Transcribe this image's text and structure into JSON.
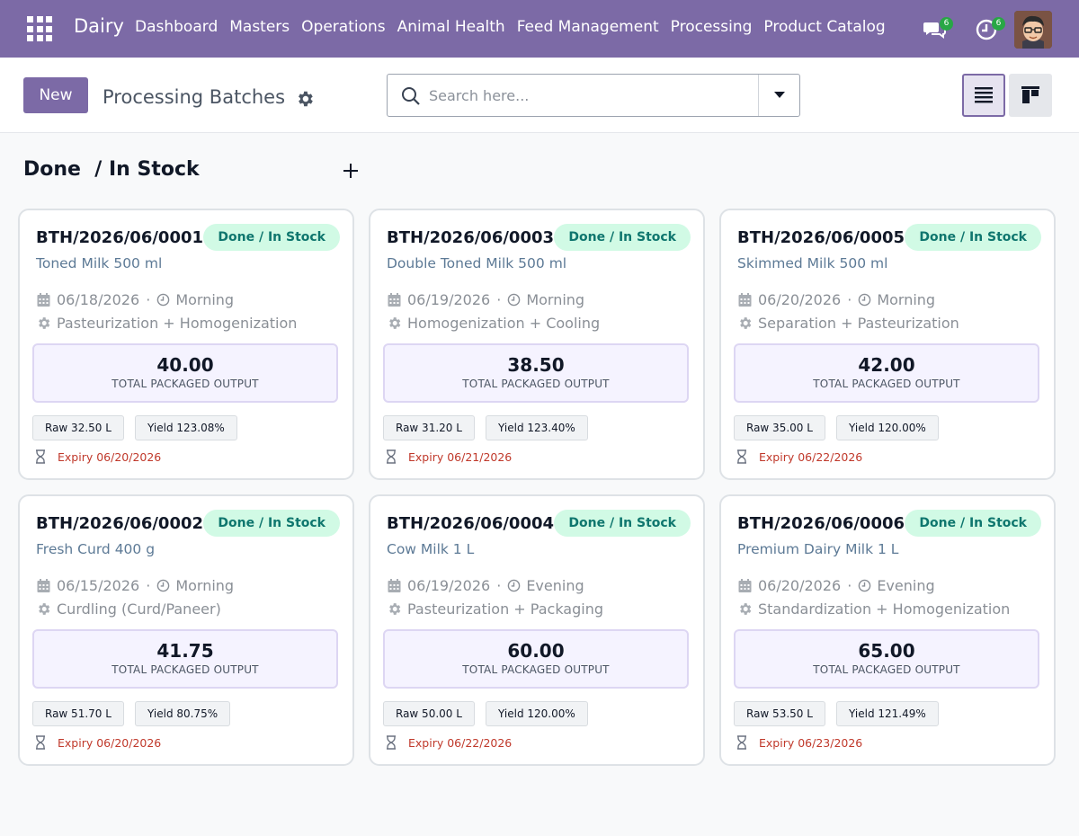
{
  "app": {
    "brand": "Dairy"
  },
  "nav": {
    "menu": [
      "Dashboard",
      "Masters",
      "Operations",
      "Animal Health",
      "Feed Management",
      "Processing",
      "Product Catalog"
    ],
    "messages_count": "6",
    "activities_count": "6"
  },
  "control": {
    "new_label": "New",
    "title": "Processing Batches",
    "search_placeholder": "Search here..."
  },
  "column": {
    "title": "Done  / In Stock"
  },
  "card_labels": {
    "output_label": "TOTAL PACKAGED OUTPUT",
    "date_sep": "·"
  },
  "cards": [
    {
      "ref": "BTH/2026/06/0001",
      "status": "Done / In Stock",
      "product": "Toned Milk 500 ml",
      "date": "06/18/2026",
      "shift": "Morning",
      "process": "Pasteurization + Homogenization",
      "output": "40.00",
      "raw": "Raw 32.50 L",
      "yield": "Yield 123.08%",
      "expiry": "Expiry 06/20/2026"
    },
    {
      "ref": "BTH/2026/06/0003",
      "status": "Done / In Stock",
      "product": "Double Toned Milk 500 ml",
      "date": "06/19/2026",
      "shift": "Morning",
      "process": "Homogenization + Cooling",
      "output": "38.50",
      "raw": "Raw 31.20 L",
      "yield": "Yield 123.40%",
      "expiry": "Expiry 06/21/2026"
    },
    {
      "ref": "BTH/2026/06/0005",
      "status": "Done / In Stock",
      "product": "Skimmed Milk 500 ml",
      "date": "06/20/2026",
      "shift": "Morning",
      "process": "Separation + Pasteurization",
      "output": "42.00",
      "raw": "Raw 35.00 L",
      "yield": "Yield 120.00%",
      "expiry": "Expiry 06/22/2026"
    },
    {
      "ref": "BTH/2026/06/0002",
      "status": "Done / In Stock",
      "product": "Fresh Curd 400 g",
      "date": "06/15/2026",
      "shift": "Morning",
      "process": "Curdling (Curd/Paneer)",
      "output": "41.75",
      "raw": "Raw 51.70 L",
      "yield": "Yield 80.75%",
      "expiry": "Expiry 06/20/2026"
    },
    {
      "ref": "BTH/2026/06/0004",
      "status": "Done / In Stock",
      "product": "Cow Milk 1 L",
      "date": "06/19/2026",
      "shift": "Evening",
      "process": "Pasteurization + Packaging",
      "output": "60.00",
      "raw": "Raw 50.00 L",
      "yield": "Yield 120.00%",
      "expiry": "Expiry 06/22/2026"
    },
    {
      "ref": "BTH/2026/06/0006",
      "status": "Done / In Stock",
      "product": "Premium Dairy Milk 1 L",
      "date": "06/20/2026",
      "shift": "Evening",
      "process": "Standardization + Homogenization",
      "output": "65.00",
      "raw": "Raw 53.50 L",
      "yield": "Yield 121.49%",
      "expiry": "Expiry 06/23/2026"
    }
  ],
  "colors": {
    "brand": "#7c6aa6",
    "status_bg": "#d1fae5",
    "status_text": "#0f766e",
    "expiry": "#c0392b"
  },
  "icons": [
    "apps-grid-icon",
    "chat-icon",
    "clock-icon",
    "search-icon",
    "caret-down-icon",
    "gear-icon",
    "list-view-icon",
    "kanban-view-icon",
    "plus-icon",
    "calendar-icon",
    "hourglass-icon"
  ]
}
